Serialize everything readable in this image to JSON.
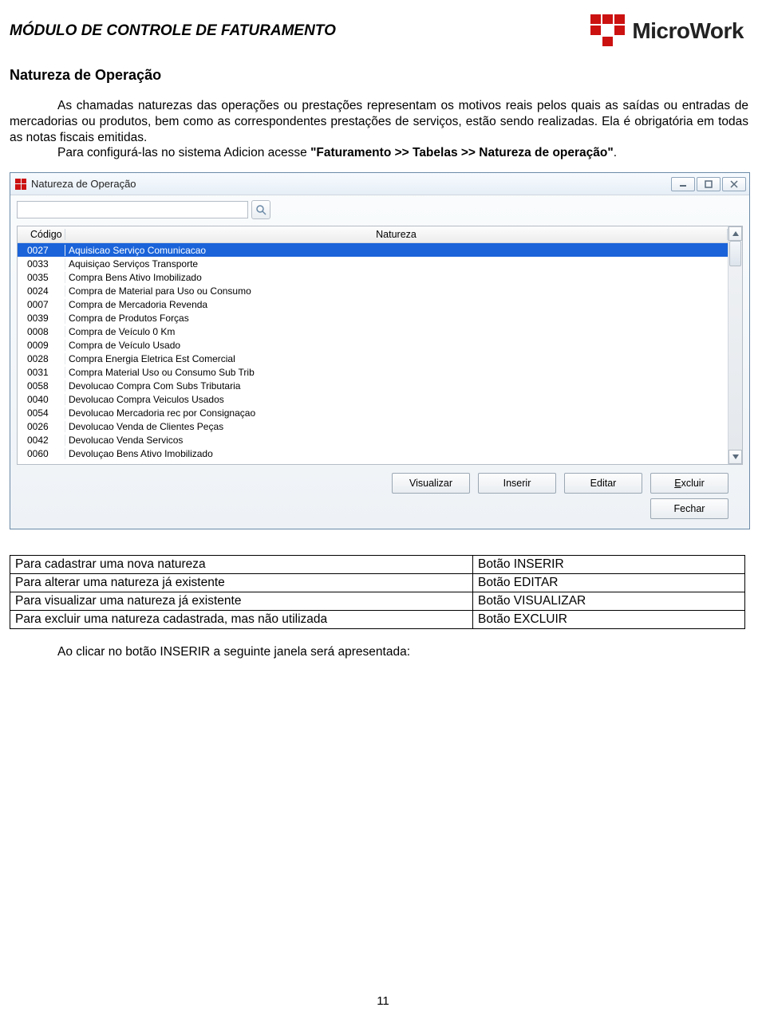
{
  "header": {
    "module_title": "MÓDULO DE CONTROLE DE FATURAMENTO",
    "brand_name": "MicroWork"
  },
  "section": {
    "title": "Natureza de Operação",
    "paragraph1": "As chamadas naturezas das operações ou prestações representam os motivos reais pelos quais as saídas ou entradas de mercadorias ou produtos, bem como as correspondentes prestações de serviços, estão sendo realizadas. Ela é obrigatória em todas as notas fiscais emitidas.",
    "paragraph2_pre": "Para configurá-las no sistema Adicion acesse ",
    "paragraph2_bold": "\"Faturamento >> Tabelas >> Natureza de operação\"",
    "paragraph2_post": "."
  },
  "window": {
    "title": "Natureza de Operação",
    "search_placeholder": "",
    "columns": {
      "codigo": "Código",
      "natureza": "Natureza"
    },
    "rows": [
      {
        "codigo": "0027",
        "natureza": "Aquisicao  Serviço Comunicacao",
        "selected": true
      },
      {
        "codigo": "0033",
        "natureza": "Aquisiçao Serviços Transporte"
      },
      {
        "codigo": "0035",
        "natureza": "Compra Bens  Ativo Imobilizado"
      },
      {
        "codigo": "0024",
        "natureza": "Compra de Material para Uso ou Consumo"
      },
      {
        "codigo": "0007",
        "natureza": "Compra de Mercadoria Revenda"
      },
      {
        "codigo": "0039",
        "natureza": "Compra de Produtos Forças"
      },
      {
        "codigo": "0008",
        "natureza": "Compra de Veículo 0 Km"
      },
      {
        "codigo": "0009",
        "natureza": "Compra de Veículo Usado"
      },
      {
        "codigo": "0028",
        "natureza": "Compra Energia Eletrica Est Comercial"
      },
      {
        "codigo": "0031",
        "natureza": "Compra Material Uso ou Consumo Sub Trib"
      },
      {
        "codigo": "0058",
        "natureza": "Devolucao Compra Com Subs Tributaria"
      },
      {
        "codigo": "0040",
        "natureza": "Devolucao Compra Veiculos Usados"
      },
      {
        "codigo": "0054",
        "natureza": "Devolucao Mercadoria rec por Consignaçao"
      },
      {
        "codigo": "0026",
        "natureza": "Devolucao Venda de Clientes Peças"
      },
      {
        "codigo": "0042",
        "natureza": "Devolucao Venda Servicos"
      },
      {
        "codigo": "0060",
        "natureza": "Devoluçao Bens Ativo Imobilizado"
      }
    ],
    "buttons": {
      "visualizar": "Visualizar",
      "inserir": "Inserir",
      "editar": "Editar",
      "excluir": "Excluir",
      "fechar": "Fechar"
    }
  },
  "actions_table": [
    {
      "action": "Para cadastrar uma nova natureza",
      "button": "Botão INSERIR"
    },
    {
      "action": "Para alterar uma natureza já existente",
      "button": "Botão EDITAR"
    },
    {
      "action": "Para visualizar uma natureza já existente",
      "button": "Botão VISUALIZAR"
    },
    {
      "action": "Para excluir uma natureza cadastrada, mas não utilizada",
      "button": "Botão EXCLUIR"
    }
  ],
  "follow_text": "Ao clicar no botão INSERIR a seguinte janela será apresentada:",
  "page_number": "11"
}
